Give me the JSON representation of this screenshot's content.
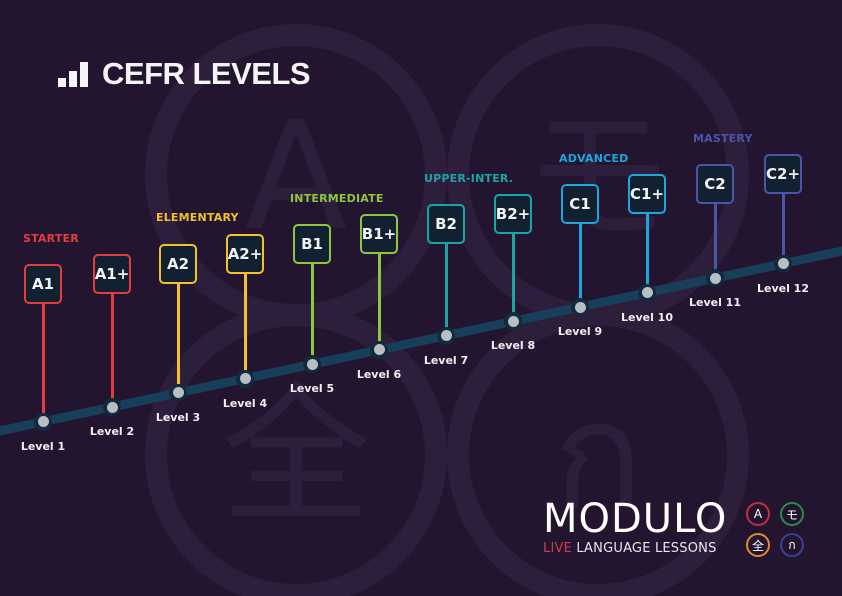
{
  "title": {
    "text": "CEFR LEVELS",
    "icon": "bar-chart-icon"
  },
  "colors": {
    "background": "#231530",
    "line": "#173f5a",
    "starter": "#e43d40",
    "elementary": "#f5c02c",
    "intermediate": "#8dc63f",
    "upper_inter": "#1aa5a5",
    "advanced": "#1aa7dc",
    "mastery": "#4a4f9e"
  },
  "categories": [
    {
      "label": "STARTER",
      "color": "#e43d40"
    },
    {
      "label": "ELEMENTARY",
      "color": "#f5c02c"
    },
    {
      "label": "INTERMEDIATE",
      "color": "#8dc63f"
    },
    {
      "label": "UPPER-INTER.",
      "color": "#1aa5a5"
    },
    {
      "label": "ADVANCED",
      "color": "#1aa7dc"
    },
    {
      "label": "MASTERY",
      "color": "#4a55a8"
    }
  ],
  "levels": [
    {
      "code": "A1",
      "label": "Level 1",
      "category": 0
    },
    {
      "code": "A1+",
      "label": "Level 2",
      "category": 0
    },
    {
      "code": "A2",
      "label": "Level 3",
      "category": 1
    },
    {
      "code": "A2+",
      "label": "Level 4",
      "category": 1
    },
    {
      "code": "B1",
      "label": "Level 5",
      "category": 2
    },
    {
      "code": "B1+",
      "label": "Level 6",
      "category": 2
    },
    {
      "code": "B2",
      "label": "Level 7",
      "category": 3
    },
    {
      "code": "B2+",
      "label": "Level 8",
      "category": 3
    },
    {
      "code": "C1",
      "label": "Level 9",
      "category": 4
    },
    {
      "code": "C1+",
      "label": "Level 10",
      "category": 4
    },
    {
      "code": "C2",
      "label": "Level 11",
      "category": 5
    },
    {
      "code": "C2+",
      "label": "Level 12",
      "category": 5
    }
  ],
  "brand": {
    "name": "MODULO",
    "tagline_highlight": "LIVE",
    "tagline_rest": " LANGUAGE LESSONS",
    "bubbles": [
      {
        "glyph": "A",
        "color": "#c0303a"
      },
      {
        "glyph": "モ",
        "color": "#2e8a4a"
      },
      {
        "glyph": "全",
        "color": "#e08a2a"
      },
      {
        "glyph": "ก",
        "color": "#3a3f9a"
      }
    ]
  },
  "background_glyphs": [
    "A",
    "モ",
    "全",
    "ก"
  ]
}
